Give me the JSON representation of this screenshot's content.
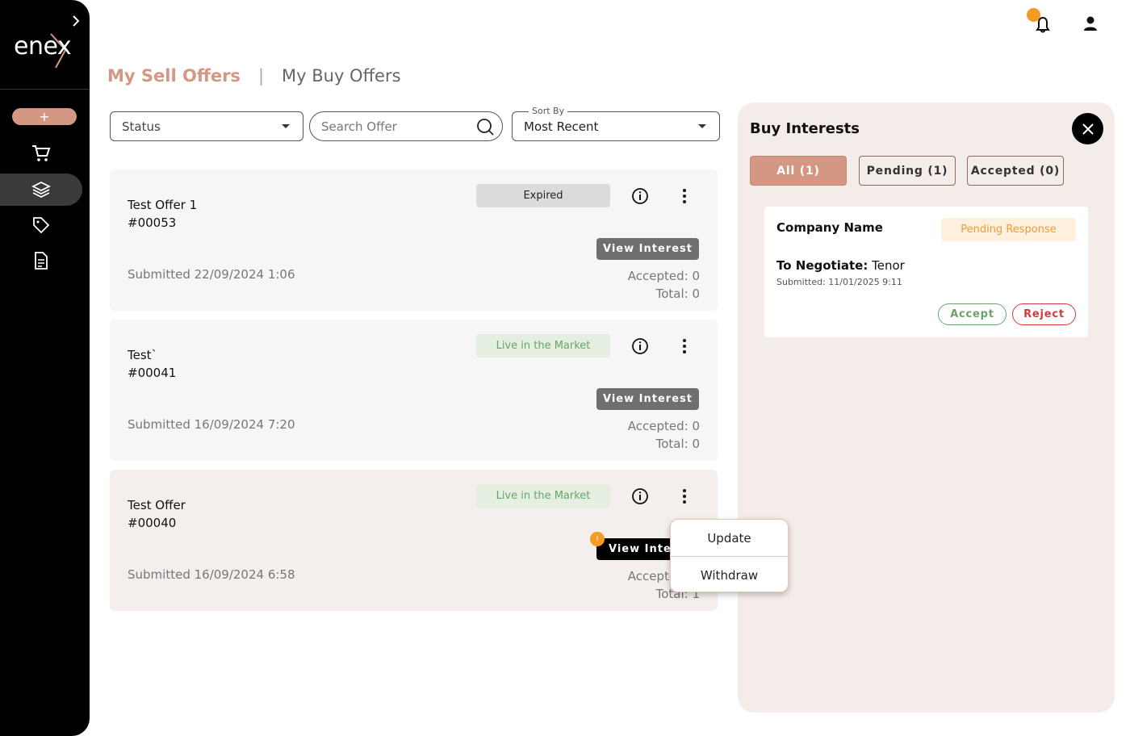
{
  "brand": {
    "logo_text": "enex",
    "accent": "#d49783"
  },
  "sidebar": {
    "add_label": "+",
    "items": [
      {
        "name": "cart",
        "icon": "cart-icon"
      },
      {
        "name": "layers",
        "icon": "layers-icon",
        "active": true
      },
      {
        "name": "tag",
        "icon": "tag-icon"
      },
      {
        "name": "document",
        "icon": "document-icon"
      }
    ]
  },
  "tabs": {
    "active": "My Sell Offers",
    "inactive": "My Buy Offers"
  },
  "filters": {
    "status_label": "Status",
    "search_placeholder": "Search Offer",
    "sort_label": "Sort By",
    "sort_value": "Most Recent"
  },
  "offers": [
    {
      "title": "Test Offer 1",
      "id": "#00053",
      "status": "Expired",
      "view_label": "View Interest",
      "submitted": "Submitted 22/09/2024 1:06",
      "accepted": "Accepted: 0",
      "total": "Total: 0"
    },
    {
      "title": "Test`",
      "id": "#00041",
      "status": "Live in the Market",
      "view_label": "View Interest",
      "submitted": "Submitted 16/09/2024 7:20",
      "accepted": "Accepted: 0",
      "total": "Total: 0"
    },
    {
      "title": "Test Offer",
      "id": "#00040",
      "status": "Live in the Market",
      "view_label": "View Interest",
      "notify_count": "!",
      "submitted": "Submitted 16/09/2024 6:58",
      "accepted": "Accepted: 0",
      "total": "Total: 1"
    }
  ],
  "context_menu": {
    "update": "Update",
    "withdraw": "Withdraw"
  },
  "panel": {
    "title": "Buy Interests",
    "tabs": {
      "all": "All (1)",
      "pending": "Pending (1)",
      "accepted": "Accepted (0)"
    },
    "interest": {
      "company": "Company Name",
      "status": "Pending Response",
      "negotiate_label": "To Negotiate:",
      "negotiate_value": " Tenor",
      "submitted": "Submitted: 11/01/2025 9:11",
      "accept_label": "Accept",
      "reject_label": "Reject"
    }
  }
}
